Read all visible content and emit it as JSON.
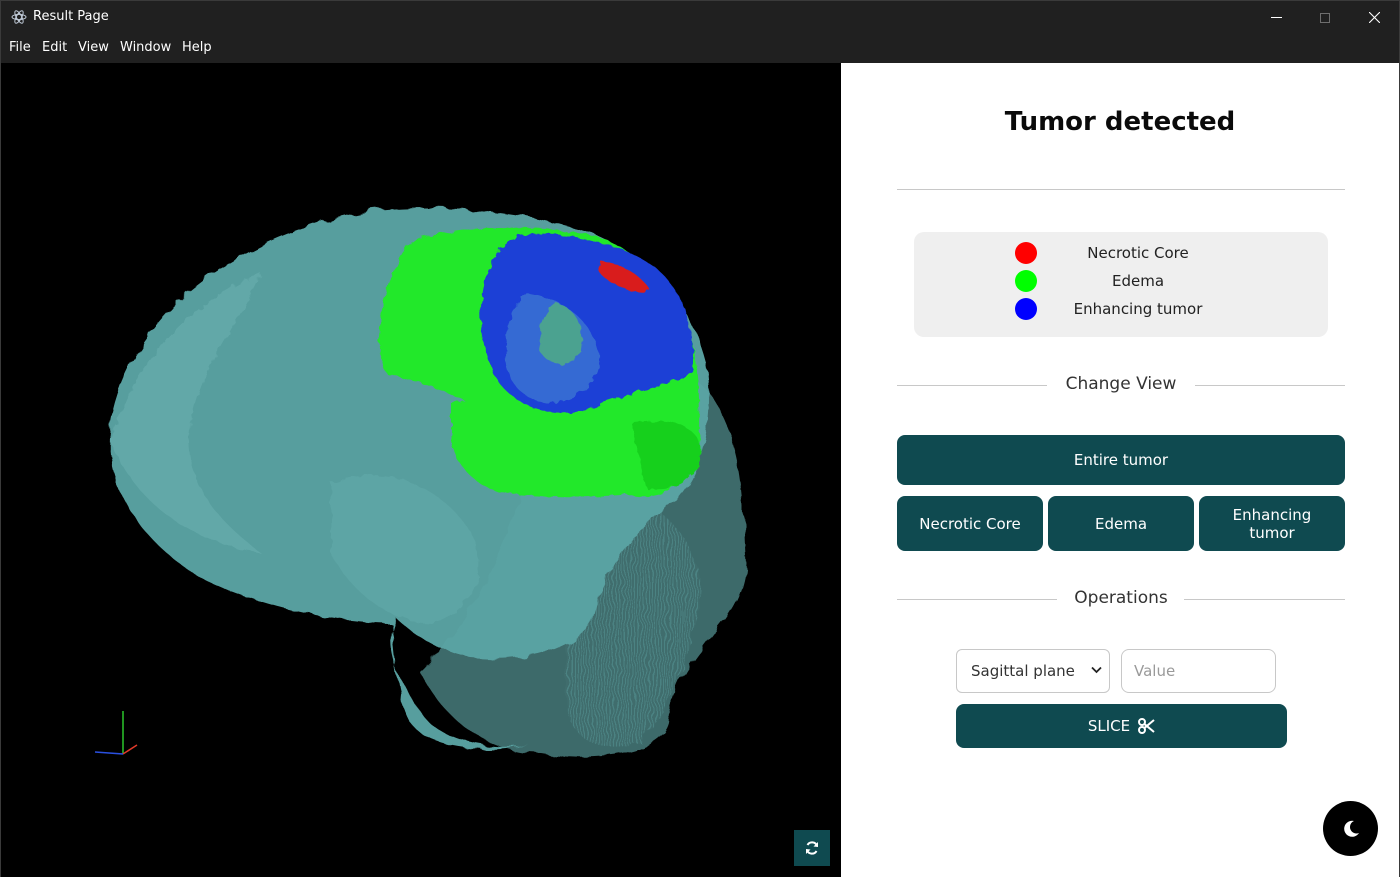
{
  "window": {
    "title": "Result Page",
    "controls": {
      "minimize": "—",
      "maximize": "☐",
      "close": "✕"
    }
  },
  "menu": [
    "File",
    "Edit",
    "View",
    "Window",
    "Help"
  ],
  "viewer": {
    "reset_icon": "refresh-icon",
    "axes_icon": "xyz-axes"
  },
  "panel": {
    "status": "Tumor detected",
    "legend": [
      {
        "label": "Necrotic Core",
        "color": "#ff0000"
      },
      {
        "label": "Edema",
        "color": "#00ff00"
      },
      {
        "label": "Enhancing tumor",
        "color": "#0000ff"
      }
    ],
    "change_view": {
      "heading": "Change View",
      "entire_label": "Entire tumor",
      "buttons": [
        "Necrotic Core",
        "Edema",
        "Enhancing tumor"
      ]
    },
    "operations": {
      "heading": "Operations",
      "plane_selected": "Sagittal plane",
      "value_placeholder": "Value",
      "slice_label": "SLICE"
    },
    "theme_toggle_icon": "moon-icon"
  },
  "colors": {
    "accent": "#0f4a50",
    "brain": "#5aa3a3",
    "edema": "#22e82a",
    "enhancing": "#1a3fd6",
    "necrotic": "#ff2020"
  }
}
